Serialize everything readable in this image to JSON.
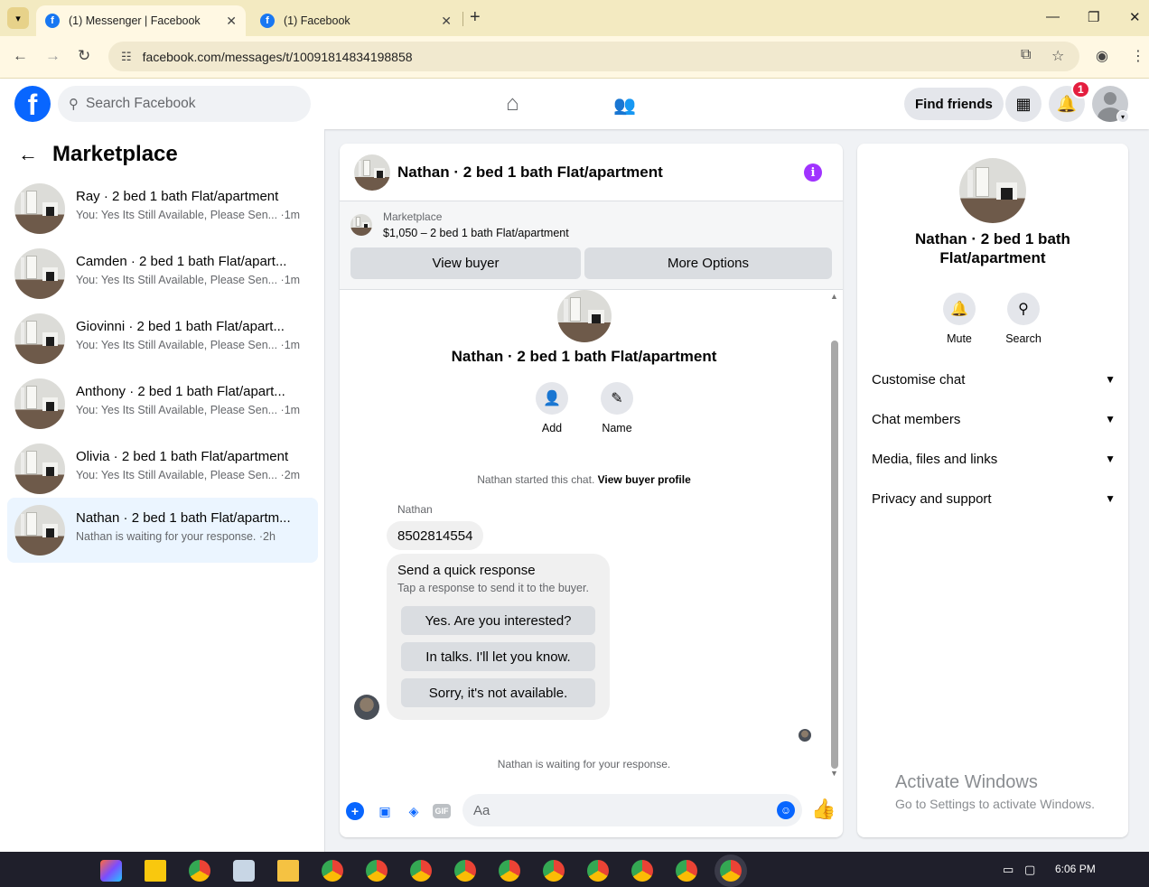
{
  "browser": {
    "tabs": [
      {
        "title": "(1) Messenger | Facebook",
        "active": true
      },
      {
        "title": "(1) Facebook",
        "active": false
      }
    ],
    "url": "facebook.com/messages/t/10091814834198858"
  },
  "header": {
    "search_placeholder": "Search Facebook",
    "find_friends": "Find friends",
    "notification_count": "1"
  },
  "sidebar": {
    "title": "Marketplace",
    "conversations": [
      {
        "name": "Ray · 2 bed 1 bath Flat/apartment",
        "preview": "You: Yes Its Still Available, Please Sen... ·1m"
      },
      {
        "name": "Camden · 2 bed 1 bath Flat/apart...",
        "preview": "You: Yes Its Still Available, Please Sen... ·1m"
      },
      {
        "name": "Giovinni · 2 bed 1 bath Flat/apart...",
        "preview": "You: Yes Its Still Available, Please Sen... ·1m"
      },
      {
        "name": "Anthony · 2 bed 1 bath Flat/apart...",
        "preview": "You: Yes Its Still Available, Please Sen... ·1m"
      },
      {
        "name": "Olivia · 2 bed 1 bath Flat/apartment",
        "preview": "You: Yes Its Still Available, Please Sen... ·2m"
      },
      {
        "name": "Nathan · 2 bed 1 bath Flat/apartm...",
        "preview": "Nathan is waiting for your response. ·2h"
      }
    ]
  },
  "chat": {
    "title": "Nathan · 2 bed 1 bath Flat/apartment",
    "marketplace_label": "Marketplace",
    "listing": "$1,050 – 2 bed 1 bath Flat/apartment",
    "view_buyer": "View buyer",
    "more_options": "More Options",
    "info_name": "Nathan · 2 bed 1 bath Flat/apartment",
    "add_label": "Add",
    "name_label": "Name",
    "started_text": "Nathan started this chat.",
    "view_buyer_profile": "View buyer profile",
    "sender": "Nathan",
    "message": "8502814554",
    "quick_title": "Send a quick response",
    "quick_sub": "Tap a response to send it to the buyer.",
    "quick_responses": [
      "Yes. Are you interested?",
      "In talks. I'll let you know.",
      "Sorry, it's not available."
    ],
    "waiting": "Nathan is waiting for your response.",
    "composer_placeholder": "Aa",
    "gif": "GIF"
  },
  "details": {
    "name": "Nathan · 2 bed 1 bath Flat/apartment",
    "mute": "Mute",
    "search": "Search",
    "sections": [
      "Customise chat",
      "Chat members",
      "Media, files and links",
      "Privacy and support"
    ]
  },
  "watermark": {
    "line1": "Activate Windows",
    "line2": "Go to Settings to activate Windows."
  },
  "taskbar": {
    "time": "6:06 PM"
  }
}
